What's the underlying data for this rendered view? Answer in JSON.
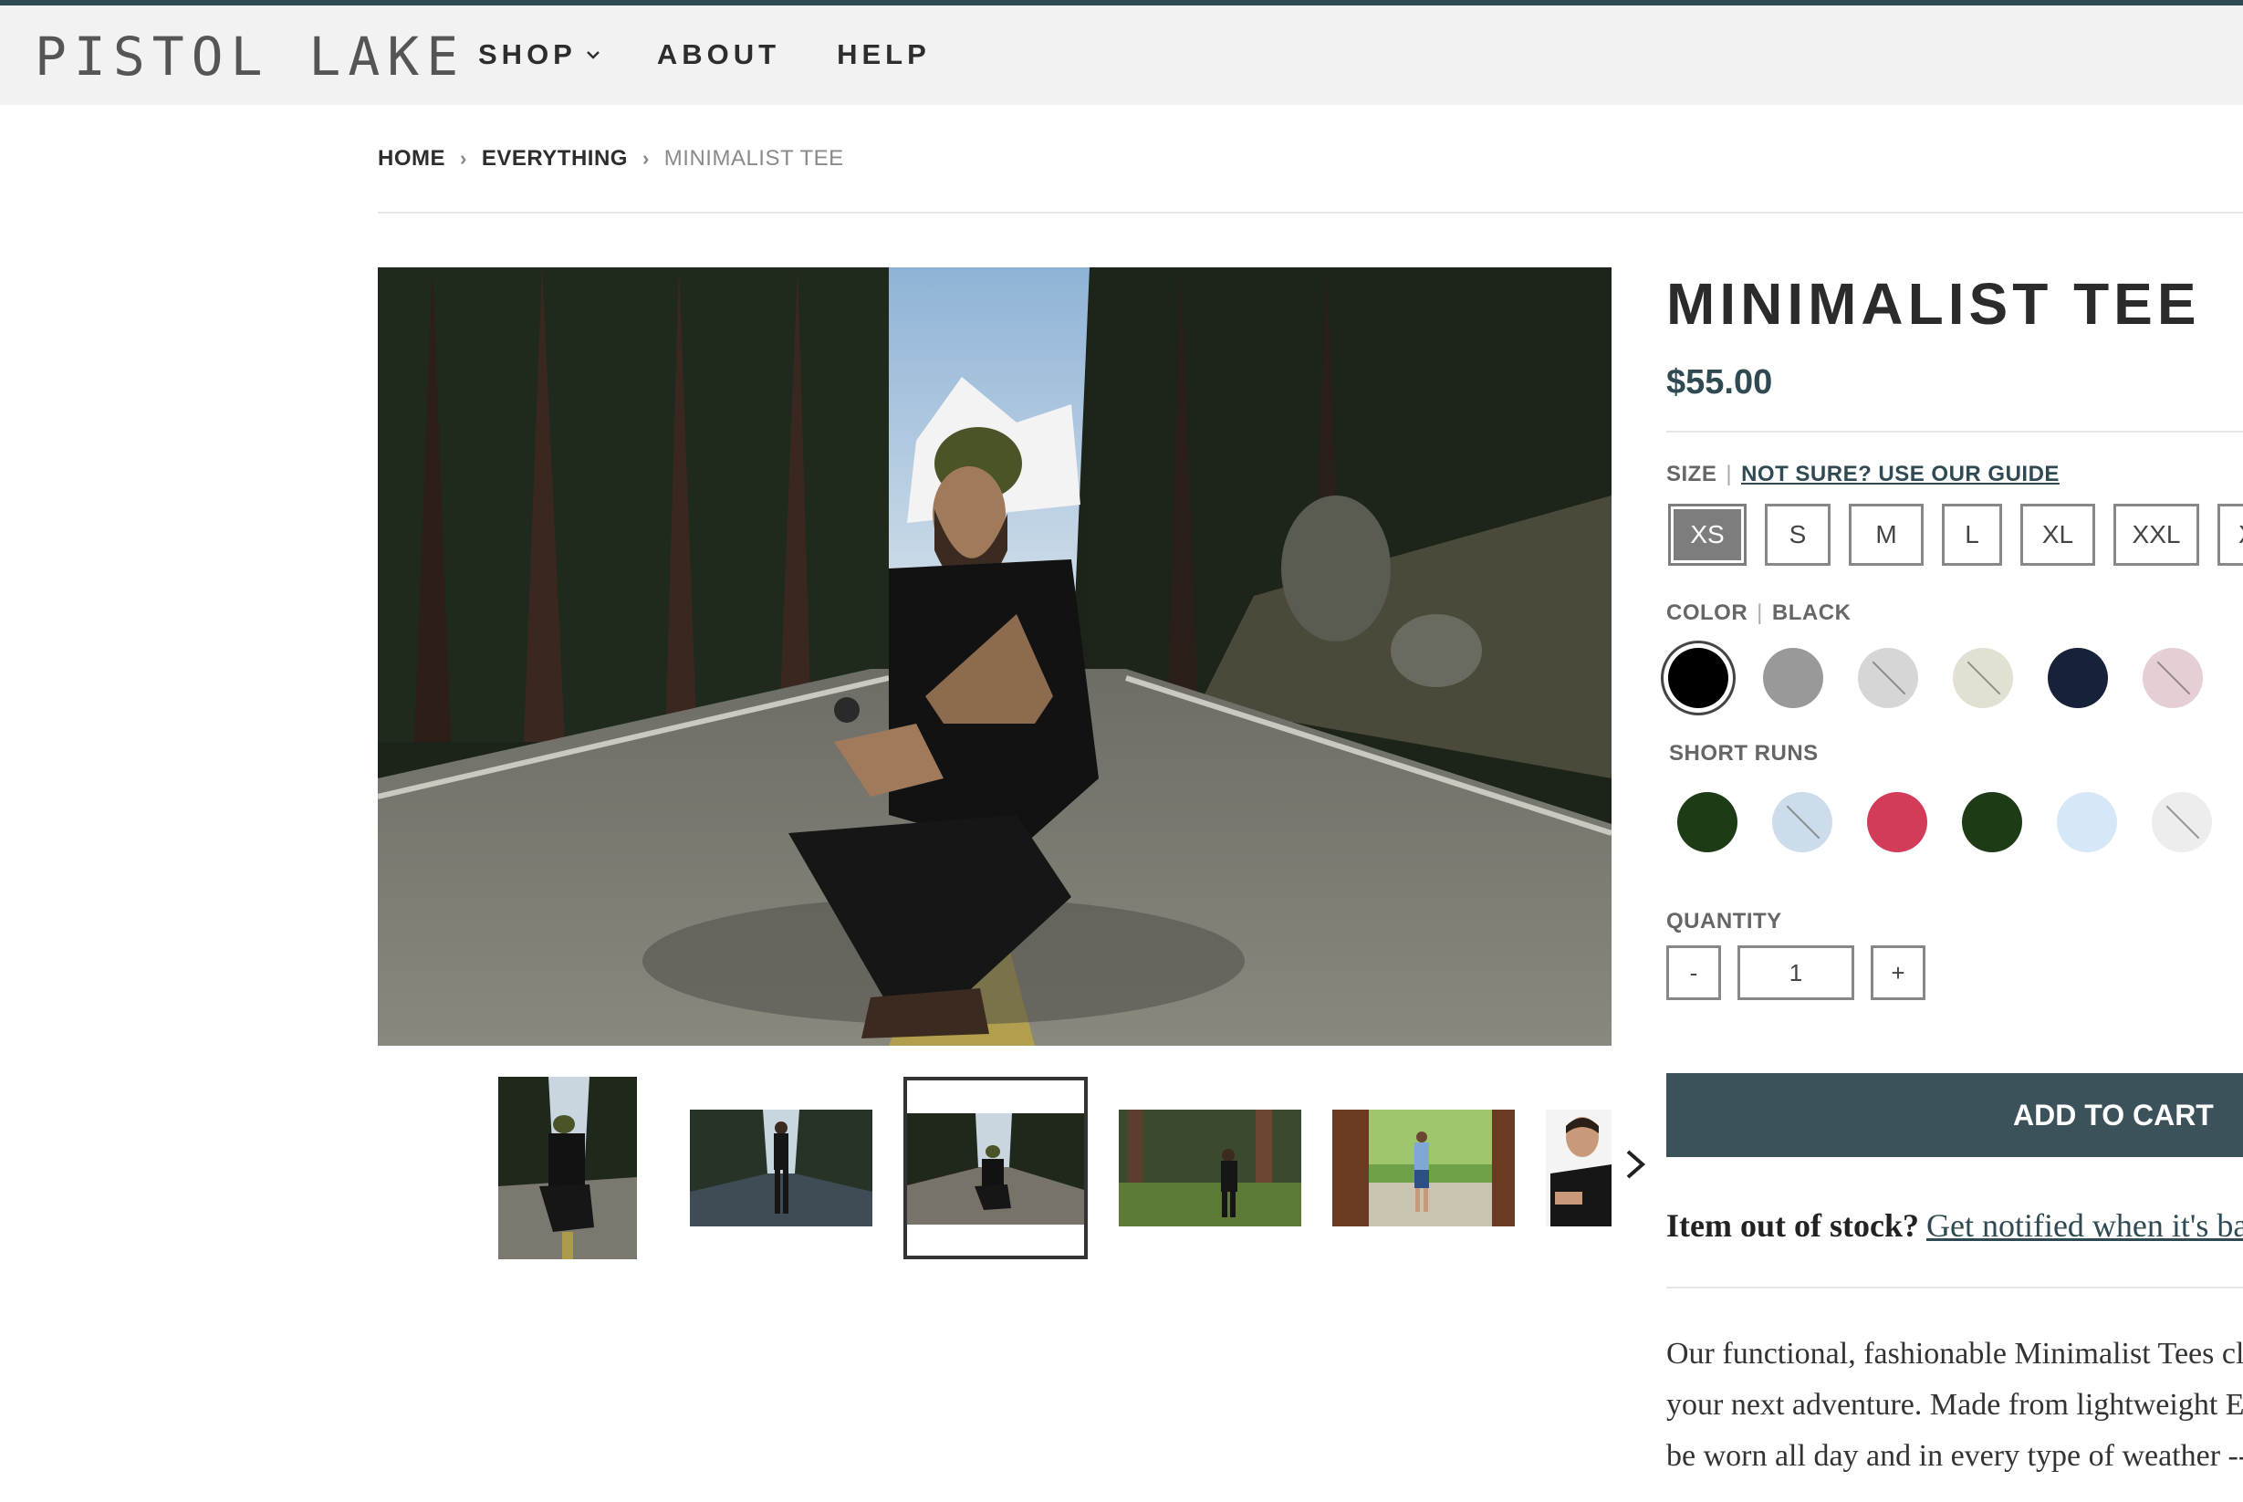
{
  "brand": {
    "logo_text": "PISTOL LAKE"
  },
  "nav": {
    "items": [
      {
        "label": "SHOP",
        "has_dropdown": true
      },
      {
        "label": "ABOUT"
      },
      {
        "label": "HELP"
      }
    ]
  },
  "breadcrumb": {
    "items": [
      "HOME",
      "EVERYTHING",
      "MINIMALIST TEE"
    ],
    "separator": "›"
  },
  "product": {
    "title": "MINIMALIST TEE",
    "price": "$55.00",
    "size_label": "SIZE",
    "size_guide_link": "NOT SURE? USE OUR GUIDE",
    "sizes": [
      "XS",
      "S",
      "M",
      "L",
      "XL",
      "XXL",
      "XL"
    ],
    "selected_size": "XS",
    "color_label": "COLOR",
    "color_value": "BLACK",
    "colors": [
      {
        "hex": "#000000",
        "selected": true,
        "unavailable": false
      },
      {
        "hex": "#999999",
        "selected": false,
        "unavailable": false
      },
      {
        "hex": "#d6d6d6",
        "selected": false,
        "unavailable": true
      },
      {
        "hex": "#e2e0d2",
        "selected": false,
        "unavailable": true
      },
      {
        "hex": "#17213a",
        "selected": false,
        "unavailable": false
      },
      {
        "hex": "#e6cfd4",
        "selected": false,
        "unavailable": true
      }
    ],
    "short_runs_label": "SHORT RUNS",
    "short_runs": [
      {
        "hex": "#1d3b15",
        "unavailable": false
      },
      {
        "hex": "#cddcea",
        "unavailable": true
      },
      {
        "hex": "#d23c58",
        "unavailable": false
      },
      {
        "hex": "#1d3b15",
        "unavailable": false
      },
      {
        "hex": "#d6e8f8",
        "unavailable": false
      },
      {
        "hex": "#ededed",
        "unavailable": true
      }
    ],
    "quantity_label": "QUANTITY",
    "quantity": "1",
    "qty_minus": "-",
    "qty_plus": "+",
    "add_to_cart": "ADD TO CART",
    "out_of_stock_q": "Item out of stock?",
    "notify_link": "Get notified when it's back",
    "notify_after": ".",
    "description_lines": [
      "Our functional, fashionable Minimalist Tees cl",
      "your next adventure. Made from lightweight E",
      "be worn all day and in every type of weather --"
    ]
  },
  "gallery": {
    "thumbnail_count": 6,
    "selected_index": 2
  },
  "icons": {
    "nav_dropdown": "chevron-down-icon",
    "gallery_next": "chevron-right-icon"
  },
  "colors": {
    "accent": "#2f4a52",
    "button": "#3b525a",
    "header_bg": "#f2f2f2"
  }
}
